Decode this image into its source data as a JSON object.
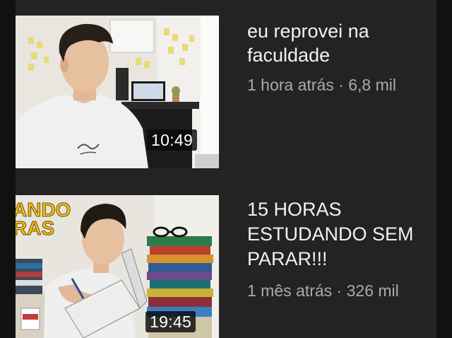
{
  "videos": [
    {
      "title_lines": [
        "eu reprovei na",
        "faculdade"
      ],
      "age": "1 hora atrás",
      "separator": "·",
      "views": "6,8 mil",
      "duration": "10:49",
      "thumbnail_overlay_text": []
    },
    {
      "title_lines": [
        "15 HORAS",
        "ESTUDANDO SEM",
        "PARAR!!!"
      ],
      "age": "1 mês atrás",
      "separator": "·",
      "views": "326 mil",
      "duration": "19:45",
      "thumbnail_overlay_text": [
        "ANDO",
        "RAS"
      ]
    }
  ],
  "colors": {
    "background": "#232323",
    "title": "#f1f1f1",
    "meta": "#aaaaaa",
    "overlay_text": "#f3c01d"
  }
}
